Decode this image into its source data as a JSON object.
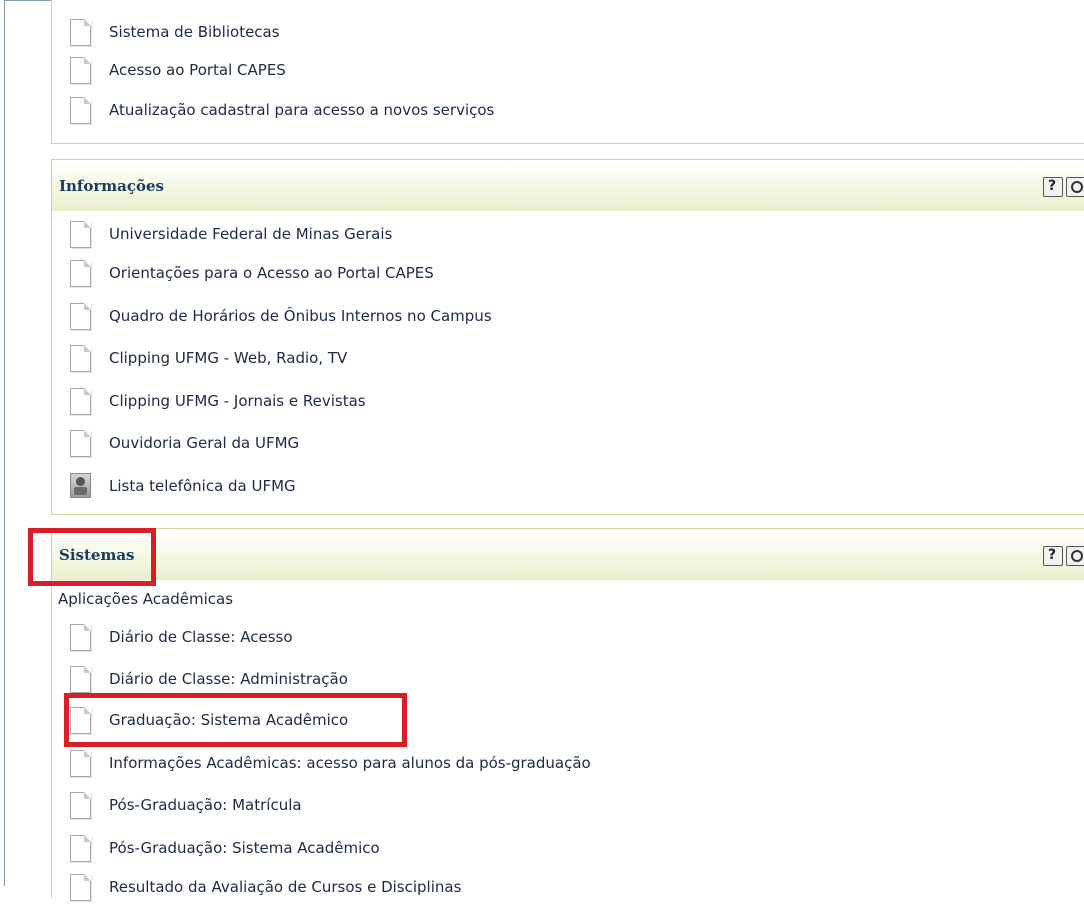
{
  "sections": {
    "top_links": [
      "Sistema de Bibliotecas",
      "Acesso ao Portal CAPES",
      "Atualização cadastral para acesso a novos serviços"
    ],
    "informacoes": {
      "title": "Informações",
      "items": [
        {
          "label": "Universidade Federal de Minas Gerais",
          "icon": "document-icon"
        },
        {
          "label": "Orientações para o Acesso ao Portal CAPES",
          "icon": "document-icon"
        },
        {
          "label": "Quadro de Horários de Ônibus Internos no Campus",
          "icon": "document-icon"
        },
        {
          "label": "Clipping UFMG - Web, Radio, TV",
          "icon": "document-icon"
        },
        {
          "label": "Clipping UFMG - Jornais e Revistas",
          "icon": "document-icon"
        },
        {
          "label": "Ouvidoria Geral da UFMG",
          "icon": "document-icon"
        },
        {
          "label": "Lista telefônica da UFMG",
          "icon": "phone-book-icon"
        }
      ]
    },
    "sistemas": {
      "title": "Sistemas",
      "subheading": "Aplicações Acadêmicas",
      "items": [
        "Diário de Classe: Acesso",
        "Diário de Classe: Administração",
        "Graduação: Sistema Acadêmico",
        "Informações Acadêmicas: acesso para alunos da pós-graduação",
        "Pós-Graduação: Matrícula",
        "Pós-Graduação: Sistema Acadêmico",
        "Resultado da Avaliação de Cursos e Disciplinas"
      ]
    }
  },
  "annotation_color": "#d81f26",
  "header_icons": [
    "help-icon",
    "search-icon"
  ]
}
